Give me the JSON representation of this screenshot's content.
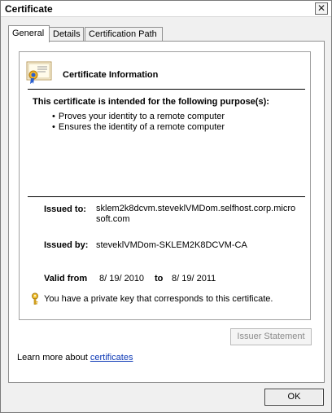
{
  "window": {
    "title": "Certificate",
    "close_glyph": "✕"
  },
  "tabs": [
    {
      "label": "General",
      "active": true
    },
    {
      "label": "Details",
      "active": false
    },
    {
      "label": "Certification Path",
      "active": false
    }
  ],
  "general": {
    "info_title": "Certificate Information",
    "purpose_heading": "This certificate is intended for the following purpose(s):",
    "purposes": [
      "Proves your identity to a remote computer",
      "Ensures the identity of a remote computer"
    ],
    "issued_to_label": "Issued to:",
    "issued_to_value": "sklem2k8dcvm.steveklVMDom.selfhost.corp.microsoft.com",
    "issued_by_label": "Issued by:",
    "issued_by_value": "steveklVMDom-SKLEM2K8DCVM-CA",
    "valid_from_label": "Valid from",
    "valid_from_value": "8/ 19/ 2010",
    "valid_to_label": "to",
    "valid_to_value": "8/ 19/ 2011",
    "private_key_text": "You have a private key that corresponds to this certificate."
  },
  "issuer_statement_label": "Issuer Statement",
  "learn_more": {
    "prefix": "Learn more about ",
    "link": "certificates"
  },
  "ok_label": "OK",
  "icons": {
    "certificate": "certificate-icon",
    "key": "key-icon",
    "close": "close-icon"
  }
}
